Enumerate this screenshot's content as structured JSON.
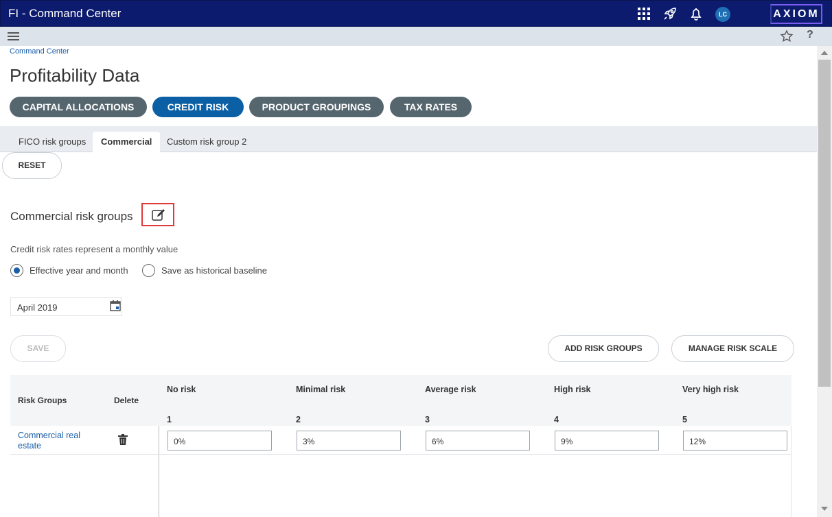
{
  "app": {
    "title": "FI - Command Center",
    "user_initials": "LC",
    "brand": "AXIOM"
  },
  "topbar": {
    "icons": [
      "apps-grid-icon",
      "rocket-icon",
      "bell-icon"
    ]
  },
  "subbar": {
    "help": "?"
  },
  "breadcrumb": "Command Center",
  "page_title": "Profitability Data",
  "nav_pills": [
    {
      "label": "CAPITAL ALLOCATIONS",
      "active": false
    },
    {
      "label": "CREDIT RISK",
      "active": true
    },
    {
      "label": "PRODUCT GROUPINGS",
      "active": false
    },
    {
      "label": "TAX RATES",
      "active": false
    }
  ],
  "tabs": [
    {
      "label": "FICO risk groups",
      "active": false
    },
    {
      "label": "Commercial",
      "active": true
    },
    {
      "label": "Custom risk group 2",
      "active": false
    }
  ],
  "reset_label": "RESET",
  "section": {
    "title": "Commercial risk groups",
    "note": "Credit risk rates represent a monthly value",
    "radio_effective": "Effective year and month",
    "radio_historical": "Save as historical baseline",
    "selected_radio": "Effective year and month",
    "date_value": "April 2019"
  },
  "buttons": {
    "save": "SAVE",
    "add_risk_groups": "ADD RISK GROUPS",
    "manage_risk_scale": "MANAGE RISK SCALE"
  },
  "grid": {
    "col_risk_groups": "Risk Groups",
    "col_delete": "Delete",
    "levels": [
      {
        "name": "No risk",
        "num": "1"
      },
      {
        "name": "Minimal risk",
        "num": "2"
      },
      {
        "name": "Average risk",
        "num": "3"
      },
      {
        "name": "High risk",
        "num": "4"
      },
      {
        "name": "Very high risk",
        "num": "5"
      }
    ],
    "rows": [
      {
        "group": "Commercial real estate",
        "rates": [
          "0%",
          "3%",
          "6%",
          "9%",
          "12%"
        ]
      }
    ]
  },
  "colors": {
    "topbar": "#0d1b6e",
    "accent": "#0b5fa5",
    "pill": "#56666f",
    "highlight": "#e03a3a"
  }
}
